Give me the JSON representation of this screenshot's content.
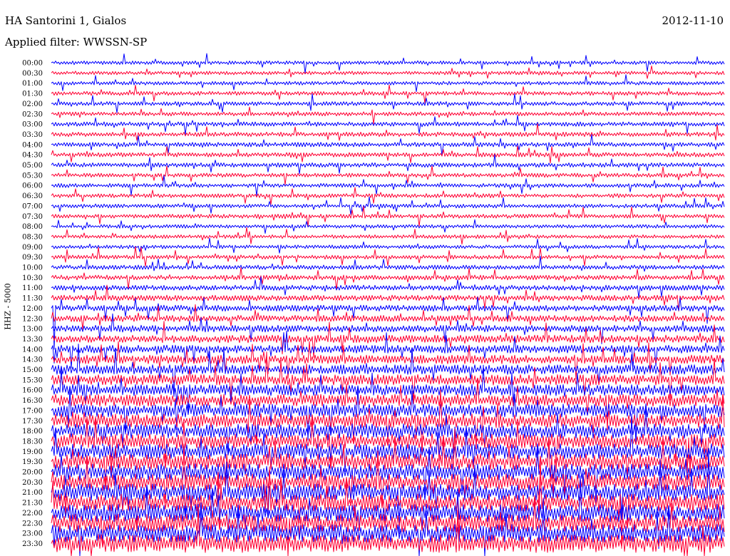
{
  "header": {
    "station": "HA Santorini 1, Gialos",
    "date": "2012-11-10",
    "filter_label": "Applied filter:",
    "filter_value": "WWSSN-SP"
  },
  "chart_data": {
    "type": "helicorder",
    "channel_label": "HHZ - 5000",
    "row_labels": [
      "00:00",
      "00:30",
      "01:00",
      "01:30",
      "02:00",
      "02:30",
      "03:00",
      "03:30",
      "04:00",
      "04:30",
      "05:00",
      "05:30",
      "06:00",
      "06:30",
      "07:00",
      "07:30",
      "08:00",
      "08:30",
      "09:00",
      "09:30",
      "10:00",
      "10:30",
      "11:00",
      "11:30",
      "12:00",
      "12:30",
      "13:00",
      "13:30",
      "14:00",
      "14:30",
      "15:00",
      "15:30",
      "16:00",
      "16:30",
      "17:00",
      "17:30",
      "18:00",
      "18:30",
      "19:00",
      "19:30",
      "20:00",
      "20:30",
      "21:00",
      "21:30",
      "22:00",
      "22:30",
      "23:00",
      "23:30"
    ],
    "row_interval_minutes": 30,
    "trace_colors": [
      "#0000ff",
      "#ff0033"
    ],
    "noise_level_by_row": [
      0.45,
      0.45,
      0.45,
      0.5,
      0.5,
      0.5,
      0.55,
      0.55,
      0.55,
      0.55,
      0.55,
      0.5,
      0.5,
      0.5,
      0.5,
      0.5,
      0.45,
      0.45,
      0.45,
      0.5,
      0.55,
      0.6,
      0.65,
      0.7,
      0.75,
      0.8,
      0.85,
      0.95,
      1.0,
      1.1,
      1.2,
      1.3,
      1.4,
      1.5,
      1.6,
      1.7,
      1.8,
      1.85,
      1.9,
      1.95,
      2.0,
      2.05,
      2.1,
      2.15,
      2.2,
      2.2,
      2.2,
      2.25
    ],
    "grid": false
  }
}
